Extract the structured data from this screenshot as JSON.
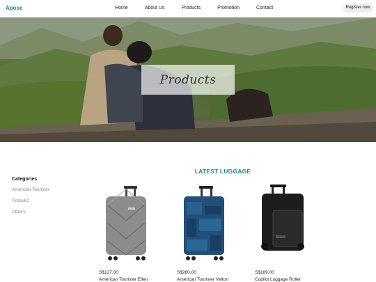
{
  "header": {
    "logo": "Apose",
    "nav": [
      "Home",
      "About Us",
      "Products",
      "Promotion",
      "Contact"
    ],
    "register_label": "Register now"
  },
  "hero": {
    "title": "Products"
  },
  "sidebar": {
    "heading": "Categories",
    "items": [
      "American Tourister",
      "Timbuk2",
      "Others"
    ]
  },
  "main": {
    "section_title": "LATEST LUGGAGE",
    "products": [
      {
        "price": "S$127.00",
        "name": "American Tourister Ellen"
      },
      {
        "price": "S$280.00",
        "name": "American Tourister Velton"
      },
      {
        "price": "S$189.00",
        "name": "Copilot Luggage Roller"
      }
    ]
  },
  "colors": {
    "accent": "#1a8a8a"
  }
}
